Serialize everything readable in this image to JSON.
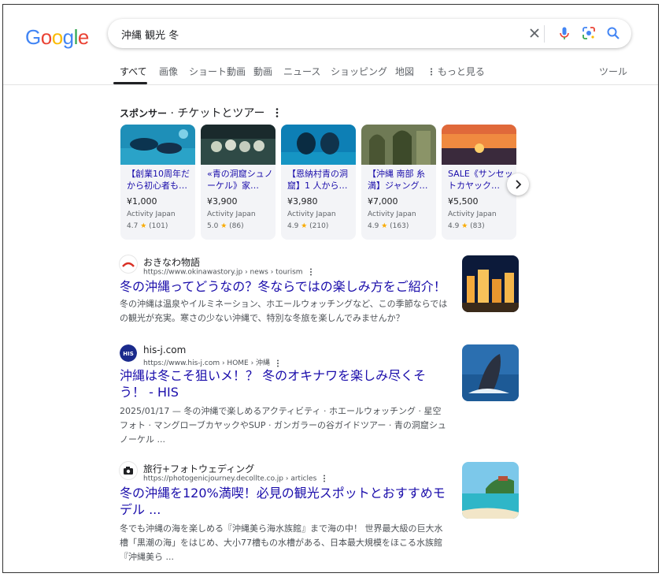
{
  "search": {
    "query": "沖縄 観光 冬"
  },
  "tabs": [
    {
      "label": "すべて"
    },
    {
      "label": "画像"
    },
    {
      "label": "ショート動画"
    },
    {
      "label": "動画"
    },
    {
      "label": "ニュース"
    },
    {
      "label": "ショッピング"
    },
    {
      "label": "地図"
    },
    {
      "label": "もっと見る"
    }
  ],
  "tools_label": "ツール",
  "sponsor": {
    "prefix": "スポンサー",
    "title": " · チケットとツアー",
    "cards": [
      {
        "title": "【創業10周年だから初心者も…",
        "price": "¥1,000",
        "vendor": "Activity Japan",
        "rating": "4.7",
        "count": "(101)"
      },
      {
        "title": "«青の洞窟シュノーケル》家…",
        "price": "¥3,900",
        "vendor": "Activity Japan",
        "rating": "5.0",
        "count": "(86)"
      },
      {
        "title": "【恩納村青の洞窟】1 人から…",
        "price": "¥3,980",
        "vendor": "Activity Japan",
        "rating": "4.9",
        "count": "(210)"
      },
      {
        "title": "【沖縄 南部 糸満】ジャング…",
        "price": "¥7,000",
        "vendor": "Activity Japan",
        "rating": "4.9",
        "count": "(163)"
      },
      {
        "title": "SALE《サンセットカヤック…",
        "price": "¥5,500",
        "vendor": "Activity Japan",
        "rating": "4.9",
        "count": "(83)"
      }
    ]
  },
  "results": [
    {
      "site": "おきなわ物語",
      "url": "https://www.okinawastory.jp › news › tourism",
      "title": "冬の沖縄ってどうなの？冬ならではの楽しみ方をご紹介！",
      "snippet": "冬の沖縄は温泉やイルミネーション、ホエールウォッチングなど、この季節ならではの観光が充実。寒さの少ない沖縄で、特別な冬旅を楽しんでみませんか？"
    },
    {
      "site": "his-j.com",
      "url": "https://www.his-j.com › HOME › 沖縄",
      "title": "沖縄は冬こそ狙いメ！？ 冬のオキナワを楽しみ尽くそう！ - HIS",
      "snippet": "2025/01/17 — 冬の沖縄で楽しめるアクティビティ · ホエールウォッチング · 星空フォト · マングローブカヤックやSUP · ガンガラーの谷ガイドツアー · 青の洞窟シュノーケル ..."
    },
    {
      "site": "旅行+フォトウェディング",
      "url": "https://photogenicjourney.decollte.co.jp › articles",
      "title": "冬の沖縄を120%満喫！必見の観光スポットとおすすめモデル ...",
      "snippet": "冬でも沖縄の海を楽しめる『沖縄美ら海水族館』まで海の中！ 世界最大級の巨大水槽「黒潮の海」をはじめ、大小77槽もの水槽がある、日本最大規模をほこる水族館『沖縄美ら ..."
    }
  ]
}
